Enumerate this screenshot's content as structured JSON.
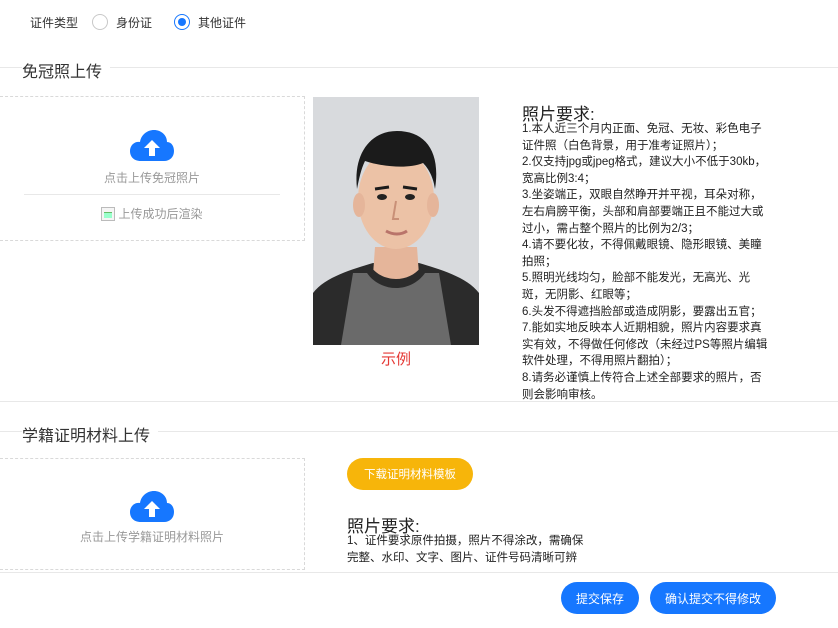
{
  "id_type": {
    "label": "证件类型",
    "options": [
      {
        "label": "身份证",
        "checked": false
      },
      {
        "label": "其他证件",
        "checked": true
      }
    ]
  },
  "photo_section": {
    "title": "免冠照上传",
    "upload_hint": "点击上传免冠照片",
    "preview_alt": "上传成功后渲染",
    "sample_label": "示例",
    "requirements_title": "照片要求:",
    "requirements": [
      "1.本人近三个月内正面、免冠、无妆、彩色电子",
      "证件照（白色背景，用于准考证照片）；",
      "2.仅支持jpg或jpeg格式，建议大小不低于30kb，",
      "宽高比例3:4；",
      "3.坐姿端正，双眼自然睁开并平视，耳朵对称，",
      "左右肩膀平衡，头部和肩部要端正且不能过大或",
      "过小，需占整个照片的比例为2/3；",
      "4.请不要化妆，不得佩戴眼镜、隐形眼镜、美瞳",
      "拍照；",
      "5.照明光线均匀，脸部不能发光，无高光、光",
      "斑，无阴影、红眼等；",
      "6.头发不得遮挡脸部或造成阴影，要露出五官；",
      "7.能如实地反映本人近期相貌，照片内容要求真",
      "实有效，不得做任何修改（未经过PS等照片编辑",
      "软件处理，不得用照片翻拍）；",
      "8.请务必谨慎上传符合上述全部要求的照片，否",
      "则会影响审核。"
    ]
  },
  "material_section": {
    "title": "学籍证明材料上传",
    "upload_hint": "点击上传学籍证明材料照片",
    "template_button": "下载证明材料模板",
    "requirements_title": "照片要求:",
    "requirements": [
      "1、证件要求原件拍摄，照片不得涂改，需确保",
      "完整、水印、文字、图片、证件号码清晰可辨"
    ]
  },
  "actions": {
    "save": "提交保存",
    "confirm": "确认提交不得修改"
  },
  "colors": {
    "primary": "#1677ff",
    "template_button": "#f7b50a",
    "sample_label": "#e53935"
  }
}
